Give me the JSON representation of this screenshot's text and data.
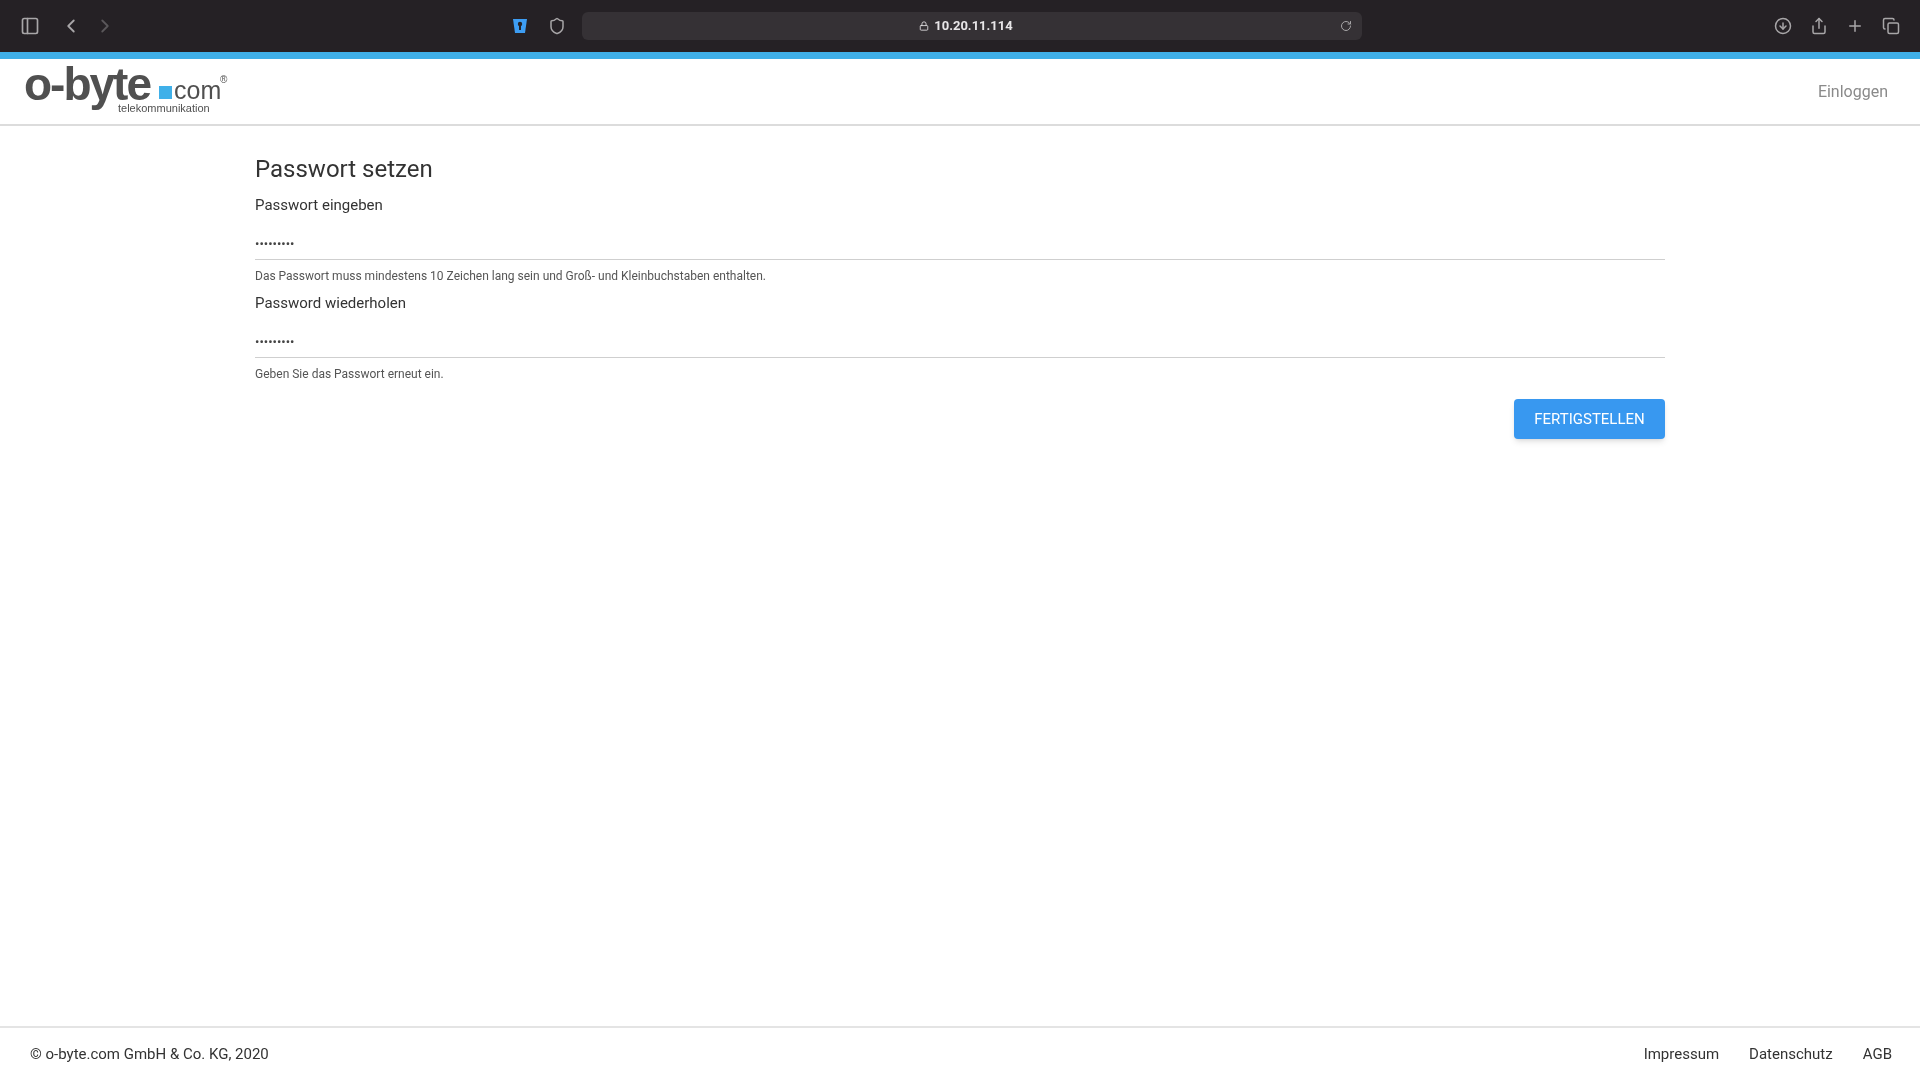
{
  "browser": {
    "address": "10.20.11.114"
  },
  "header": {
    "logo": {
      "word": "o-byte",
      "suffix": "com",
      "registered": "®",
      "tagline": "telekommunikation"
    },
    "login_link": "Einloggen"
  },
  "form": {
    "title": "Passwort setzen",
    "fields": [
      {
        "label": "Passwort eingeben",
        "value": "•••••••••",
        "hint": "Das Passwort muss mindestens 10 Zeichen lang sein und Groß- und Kleinbuchstaben enthalten."
      },
      {
        "label": "Password wiederholen",
        "value": "•••••••••",
        "hint": "Geben Sie das Passwort erneut ein."
      }
    ],
    "submit": "FERTIGSTELLEN"
  },
  "footer": {
    "copyright": "© o-byte.com GmbH & Co. KG, 2020",
    "links": [
      "Impressum",
      "Datenschutz",
      "AGB"
    ]
  }
}
